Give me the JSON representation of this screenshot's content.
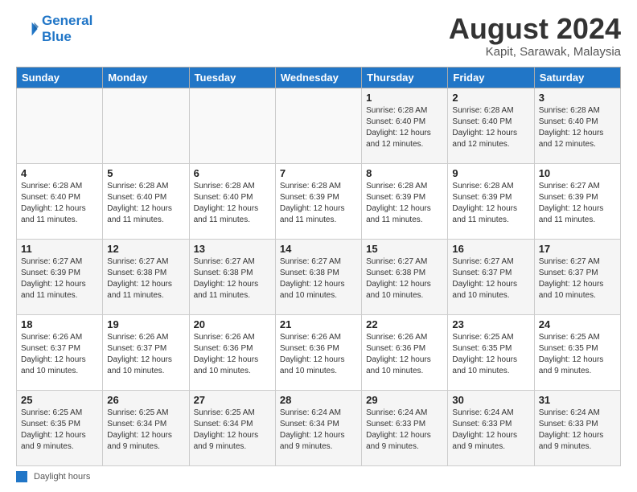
{
  "logo": {
    "line1": "General",
    "line2": "Blue"
  },
  "header": {
    "month_year": "August 2024",
    "location": "Kapit, Sarawak, Malaysia"
  },
  "days_of_week": [
    "Sunday",
    "Monday",
    "Tuesday",
    "Wednesday",
    "Thursday",
    "Friday",
    "Saturday"
  ],
  "weeks": [
    [
      {
        "day": "",
        "info": ""
      },
      {
        "day": "",
        "info": ""
      },
      {
        "day": "",
        "info": ""
      },
      {
        "day": "",
        "info": ""
      },
      {
        "day": "1",
        "info": "Sunrise: 6:28 AM\nSunset: 6:40 PM\nDaylight: 12 hours\nand 12 minutes."
      },
      {
        "day": "2",
        "info": "Sunrise: 6:28 AM\nSunset: 6:40 PM\nDaylight: 12 hours\nand 12 minutes."
      },
      {
        "day": "3",
        "info": "Sunrise: 6:28 AM\nSunset: 6:40 PM\nDaylight: 12 hours\nand 12 minutes."
      }
    ],
    [
      {
        "day": "4",
        "info": "Sunrise: 6:28 AM\nSunset: 6:40 PM\nDaylight: 12 hours\nand 11 minutes."
      },
      {
        "day": "5",
        "info": "Sunrise: 6:28 AM\nSunset: 6:40 PM\nDaylight: 12 hours\nand 11 minutes."
      },
      {
        "day": "6",
        "info": "Sunrise: 6:28 AM\nSunset: 6:40 PM\nDaylight: 12 hours\nand 11 minutes."
      },
      {
        "day": "7",
        "info": "Sunrise: 6:28 AM\nSunset: 6:39 PM\nDaylight: 12 hours\nand 11 minutes."
      },
      {
        "day": "8",
        "info": "Sunrise: 6:28 AM\nSunset: 6:39 PM\nDaylight: 12 hours\nand 11 minutes."
      },
      {
        "day": "9",
        "info": "Sunrise: 6:28 AM\nSunset: 6:39 PM\nDaylight: 12 hours\nand 11 minutes."
      },
      {
        "day": "10",
        "info": "Sunrise: 6:27 AM\nSunset: 6:39 PM\nDaylight: 12 hours\nand 11 minutes."
      }
    ],
    [
      {
        "day": "11",
        "info": "Sunrise: 6:27 AM\nSunset: 6:39 PM\nDaylight: 12 hours\nand 11 minutes."
      },
      {
        "day": "12",
        "info": "Sunrise: 6:27 AM\nSunset: 6:38 PM\nDaylight: 12 hours\nand 11 minutes."
      },
      {
        "day": "13",
        "info": "Sunrise: 6:27 AM\nSunset: 6:38 PM\nDaylight: 12 hours\nand 11 minutes."
      },
      {
        "day": "14",
        "info": "Sunrise: 6:27 AM\nSunset: 6:38 PM\nDaylight: 12 hours\nand 10 minutes."
      },
      {
        "day": "15",
        "info": "Sunrise: 6:27 AM\nSunset: 6:38 PM\nDaylight: 12 hours\nand 10 minutes."
      },
      {
        "day": "16",
        "info": "Sunrise: 6:27 AM\nSunset: 6:37 PM\nDaylight: 12 hours\nand 10 minutes."
      },
      {
        "day": "17",
        "info": "Sunrise: 6:27 AM\nSunset: 6:37 PM\nDaylight: 12 hours\nand 10 minutes."
      }
    ],
    [
      {
        "day": "18",
        "info": "Sunrise: 6:26 AM\nSunset: 6:37 PM\nDaylight: 12 hours\nand 10 minutes."
      },
      {
        "day": "19",
        "info": "Sunrise: 6:26 AM\nSunset: 6:37 PM\nDaylight: 12 hours\nand 10 minutes."
      },
      {
        "day": "20",
        "info": "Sunrise: 6:26 AM\nSunset: 6:36 PM\nDaylight: 12 hours\nand 10 minutes."
      },
      {
        "day": "21",
        "info": "Sunrise: 6:26 AM\nSunset: 6:36 PM\nDaylight: 12 hours\nand 10 minutes."
      },
      {
        "day": "22",
        "info": "Sunrise: 6:26 AM\nSunset: 6:36 PM\nDaylight: 12 hours\nand 10 minutes."
      },
      {
        "day": "23",
        "info": "Sunrise: 6:25 AM\nSunset: 6:35 PM\nDaylight: 12 hours\nand 10 minutes."
      },
      {
        "day": "24",
        "info": "Sunrise: 6:25 AM\nSunset: 6:35 PM\nDaylight: 12 hours\nand 9 minutes."
      }
    ],
    [
      {
        "day": "25",
        "info": "Sunrise: 6:25 AM\nSunset: 6:35 PM\nDaylight: 12 hours\nand 9 minutes."
      },
      {
        "day": "26",
        "info": "Sunrise: 6:25 AM\nSunset: 6:34 PM\nDaylight: 12 hours\nand 9 minutes."
      },
      {
        "day": "27",
        "info": "Sunrise: 6:25 AM\nSunset: 6:34 PM\nDaylight: 12 hours\nand 9 minutes."
      },
      {
        "day": "28",
        "info": "Sunrise: 6:24 AM\nSunset: 6:34 PM\nDaylight: 12 hours\nand 9 minutes."
      },
      {
        "day": "29",
        "info": "Sunrise: 6:24 AM\nSunset: 6:33 PM\nDaylight: 12 hours\nand 9 minutes."
      },
      {
        "day": "30",
        "info": "Sunrise: 6:24 AM\nSunset: 6:33 PM\nDaylight: 12 hours\nand 9 minutes."
      },
      {
        "day": "31",
        "info": "Sunrise: 6:24 AM\nSunset: 6:33 PM\nDaylight: 12 hours\nand 9 minutes."
      }
    ]
  ],
  "footer": {
    "legend_label": "Daylight hours"
  }
}
